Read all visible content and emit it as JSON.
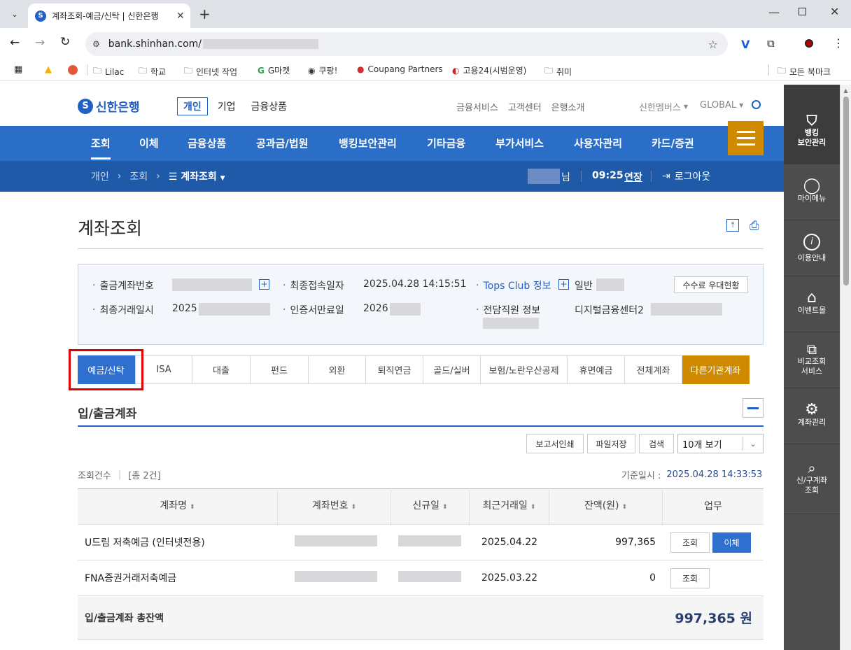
{
  "browser": {
    "tab_title": "계좌조회-예금/신탁 | 신한은행",
    "url": "bank.shinhan.com/",
    "bookmarks": [
      "Lilac",
      "학교",
      "인터넷 작업",
      "G마켓",
      "쿠팡!",
      "Coupang Partners",
      "고용24(시범운영)",
      "취미"
    ],
    "all_bookmarks": "모든 북마크"
  },
  "header": {
    "logo": "신한은행",
    "nav": [
      "개인",
      "기업",
      "금융상품"
    ],
    "util": [
      "금융서비스",
      "고객센터",
      "은행소개"
    ],
    "member": "신한멤버스",
    "global": "GLOBAL"
  },
  "gnb": [
    "조회",
    "이체",
    "금융상품",
    "공과금/법원",
    "뱅킹보안관리",
    "기타금융",
    "부가서비스",
    "사용자관리",
    "카드/증권"
  ],
  "subbar": {
    "crumbs": [
      "개인",
      "조회",
      "계좌조회"
    ],
    "user_suffix": "님",
    "time": "09:25",
    "extend": "연장",
    "logout": "로그아웃"
  },
  "page": {
    "title": "계좌조회"
  },
  "info": {
    "withdraw_account": "출금계좌번호",
    "last_access": "최종접속일자",
    "last_access_val": "2025.04.28 14:15:51",
    "tops": "Tops Club 정보",
    "tops_val": "일반",
    "fee_btn": "수수료 우대현황",
    "last_trade": "최종거래일시",
    "last_trade_val": "2025",
    "cert": "인증서만료일",
    "cert_val": "2026",
    "staff": "전담직원 정보",
    "staff_val": "디지털금융센터2"
  },
  "tabs": [
    "예금/신탁",
    "ISA",
    "대출",
    "펀드",
    "외환",
    "퇴직연금",
    "골드/실버",
    "보험/노란우산공제",
    "휴면예금",
    "전체계좌",
    "다른기관계좌"
  ],
  "section": {
    "title": "입/출금계좌",
    "buttons": [
      "보고서인쇄",
      "파일저장",
      "검색"
    ],
    "page_size": "10개 보기",
    "count_label": "조회건수",
    "count_val": "[총 2건]",
    "base_label": "기준일시 :",
    "base_val": "2025.04.28 14:33:53"
  },
  "table": {
    "headers": [
      "계좌명",
      "계좌번호",
      "신규일",
      "최근거래일",
      "잔액(원)",
      "업무"
    ],
    "rows": [
      {
        "name": "U드림 저축예금 (인터넷전용)",
        "recent": "2025.04.22",
        "balance": "997,365",
        "inquiry": "조회",
        "transfer": "이체"
      },
      {
        "name": "FNA증권거래저축예금",
        "recent": "2025.03.22",
        "balance": "0",
        "inquiry": "조회"
      }
    ],
    "total_label": "입/출금계좌 총잔액",
    "total_val": "997,365 원"
  },
  "rightbar": [
    "뱅킹\n보안관리",
    "마이메뉴",
    "이용안내",
    "이벤트몰",
    "비교조회\n서비스",
    "계좌관리",
    "신/구계좌\n조회"
  ],
  "colors": {
    "brand": "#2160c4",
    "gnb": "#2a6ec7",
    "subbar": "#1f5aa8",
    "orange": "#cf8a00",
    "rightbar": "#4d4d4d",
    "highlight": "#e00000"
  }
}
